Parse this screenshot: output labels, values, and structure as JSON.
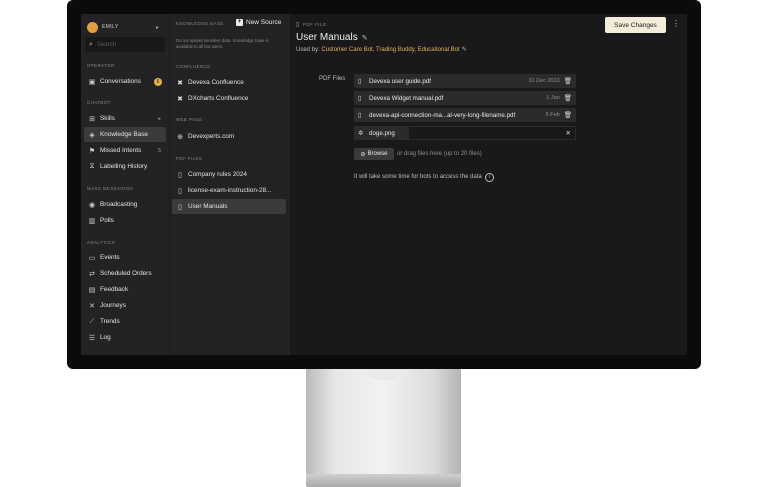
{
  "user": {
    "name": "EMILY"
  },
  "search": {
    "placeholder": "Search"
  },
  "nav": {
    "sections": [
      {
        "title": "OPERATOR",
        "items": [
          {
            "label": "Conversations",
            "icon": "chat-icon",
            "badge": "6"
          }
        ]
      },
      {
        "title": "CHATBOT",
        "items": [
          {
            "label": "Skills",
            "icon": "skills-icon"
          },
          {
            "label": "Knowledge Base",
            "icon": "knowledge-icon",
            "active": true
          },
          {
            "label": "Missed Intents",
            "icon": "flag-icon",
            "count": "5"
          },
          {
            "label": "Labelling History",
            "icon": "history-icon"
          }
        ]
      },
      {
        "title": "MASS MESSAGING",
        "items": [
          {
            "label": "Broadcasting",
            "icon": "broadcast-icon"
          },
          {
            "label": "Polls",
            "icon": "poll-icon"
          }
        ]
      },
      {
        "title": "ANALYTICS",
        "items": [
          {
            "label": "Events",
            "icon": "events-icon"
          },
          {
            "label": "Scheduled Orders",
            "icon": "schedule-icon"
          },
          {
            "label": "Feedback",
            "icon": "feedback-icon"
          },
          {
            "label": "Journeys",
            "icon": "journey-icon"
          },
          {
            "label": "Trends",
            "icon": "trends-icon"
          },
          {
            "label": "Log",
            "icon": "log-icon"
          }
        ]
      }
    ]
  },
  "kb": {
    "title": "KNOWLEDGE BASE",
    "new_source": "New Source",
    "note": "Do not upload sensitive data. Knowledge base is available to all bot users.",
    "sections": [
      {
        "title": "CONFLUENCE",
        "items": [
          {
            "label": "Devexa Confluence"
          },
          {
            "label": "DXcharts Confluence"
          }
        ]
      },
      {
        "title": "WEB PAGE",
        "items": [
          {
            "label": "Devexperts.com"
          }
        ]
      },
      {
        "title": "PDF FILES",
        "items": [
          {
            "label": "Company rules 2024"
          },
          {
            "label": "license-exam-instruction-28..."
          },
          {
            "label": "User Manuals",
            "active": true
          }
        ]
      }
    ]
  },
  "main": {
    "breadcrumb": "PDF FILE",
    "title": "User Manuals",
    "used_by_label": "Used by:",
    "used_by": "Customer Care Bot, Trading Buddy, Educational Bot",
    "save": "Save Changes",
    "pdf_label": "PDF Files",
    "files": [
      {
        "name": "Devexa user guide.pdf",
        "date": "31 Dec 2023"
      },
      {
        "name": "Devexa Widget manual.pdf",
        "date": "1 Jan"
      },
      {
        "name": "devexa-api-connection-ma...al-very-long-filename.pdf",
        "date": "5 Feb"
      }
    ],
    "uploading": {
      "name": "doge.png"
    },
    "browse": "Browse",
    "drag_hint": "or drag files here (up to 20 files)",
    "info": "It will take some time for bots to access the data"
  },
  "colors": {
    "accent": "#e3b45a",
    "save_bg": "#f3ecd8",
    "active_bg": "#3b3b3e"
  }
}
